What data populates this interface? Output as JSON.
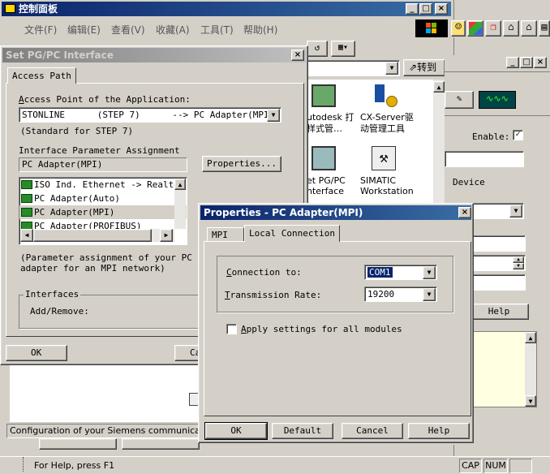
{
  "control_panel": {
    "title": "控制面板",
    "menu": [
      "文件(F)",
      "编辑(E)",
      "查看(V)",
      "收藏(A)",
      "工具(T)",
      "帮助(H)"
    ],
    "goto_label": "转到",
    "icons": [
      {
        "label1": "utodesk 打",
        "label2": "样式管…"
      },
      {
        "label1": "CX-Server驱",
        "label2": "动管理工具"
      },
      {
        "label1": "et PG/PC",
        "label2": "nterface"
      },
      {
        "label1": "SIMATIC",
        "label2": "Workstation"
      }
    ],
    "status_text": "Configuration of your Siemens communications in",
    "help_status": "For Help, press F1",
    "cap": "CAP",
    "num": "NUM"
  },
  "right_window": {
    "enable_label": "Enable:",
    "device_label": "Device",
    "help_button": "Help"
  },
  "setpg_dialog": {
    "title": "Set PG/PC Interface",
    "tab_access_path": "Access Path",
    "access_point_label": "Access Point of the Application:",
    "access_point_value": "STONLINE      (STEP 7)      --> PC Adapter(MPI)",
    "standard_note": "(Standard for STEP 7)",
    "interface_label": "Interface Parameter Assignment",
    "interface_value": "PC Adapter(MPI)",
    "properties_button": "Properties...",
    "list_items": [
      "ISO Ind. Ethernet -> Realtek",
      "PC Adapter(Auto)",
      "PC Adapter(MPI)",
      "PC Adapter(PROFIBUS)"
    ],
    "param_note1": "(Parameter assignment of your PC",
    "param_note2": "adapter for an MPI network)",
    "interfaces_group": "Interfaces",
    "add_remove_label": "Add/Remove:",
    "ok_button": "OK",
    "cancel_button": "Ca"
  },
  "props_dialog": {
    "title": "Properties - PC Adapter(MPI)",
    "tab_mpi": "MPI",
    "tab_local": "Local Connection",
    "connection_label": "Connection to:",
    "connection_value": "COM1",
    "rate_label": "Transmission Rate:",
    "rate_value": "19200",
    "apply_label": "Apply settings for all modules",
    "ok_button": "OK",
    "default_button": "Default",
    "cancel_button": "Cancel",
    "help_button": "Help"
  },
  "colors": {
    "title_active": "#0a246a",
    "selection": "#0a246a",
    "face": "#d4d0c8"
  }
}
